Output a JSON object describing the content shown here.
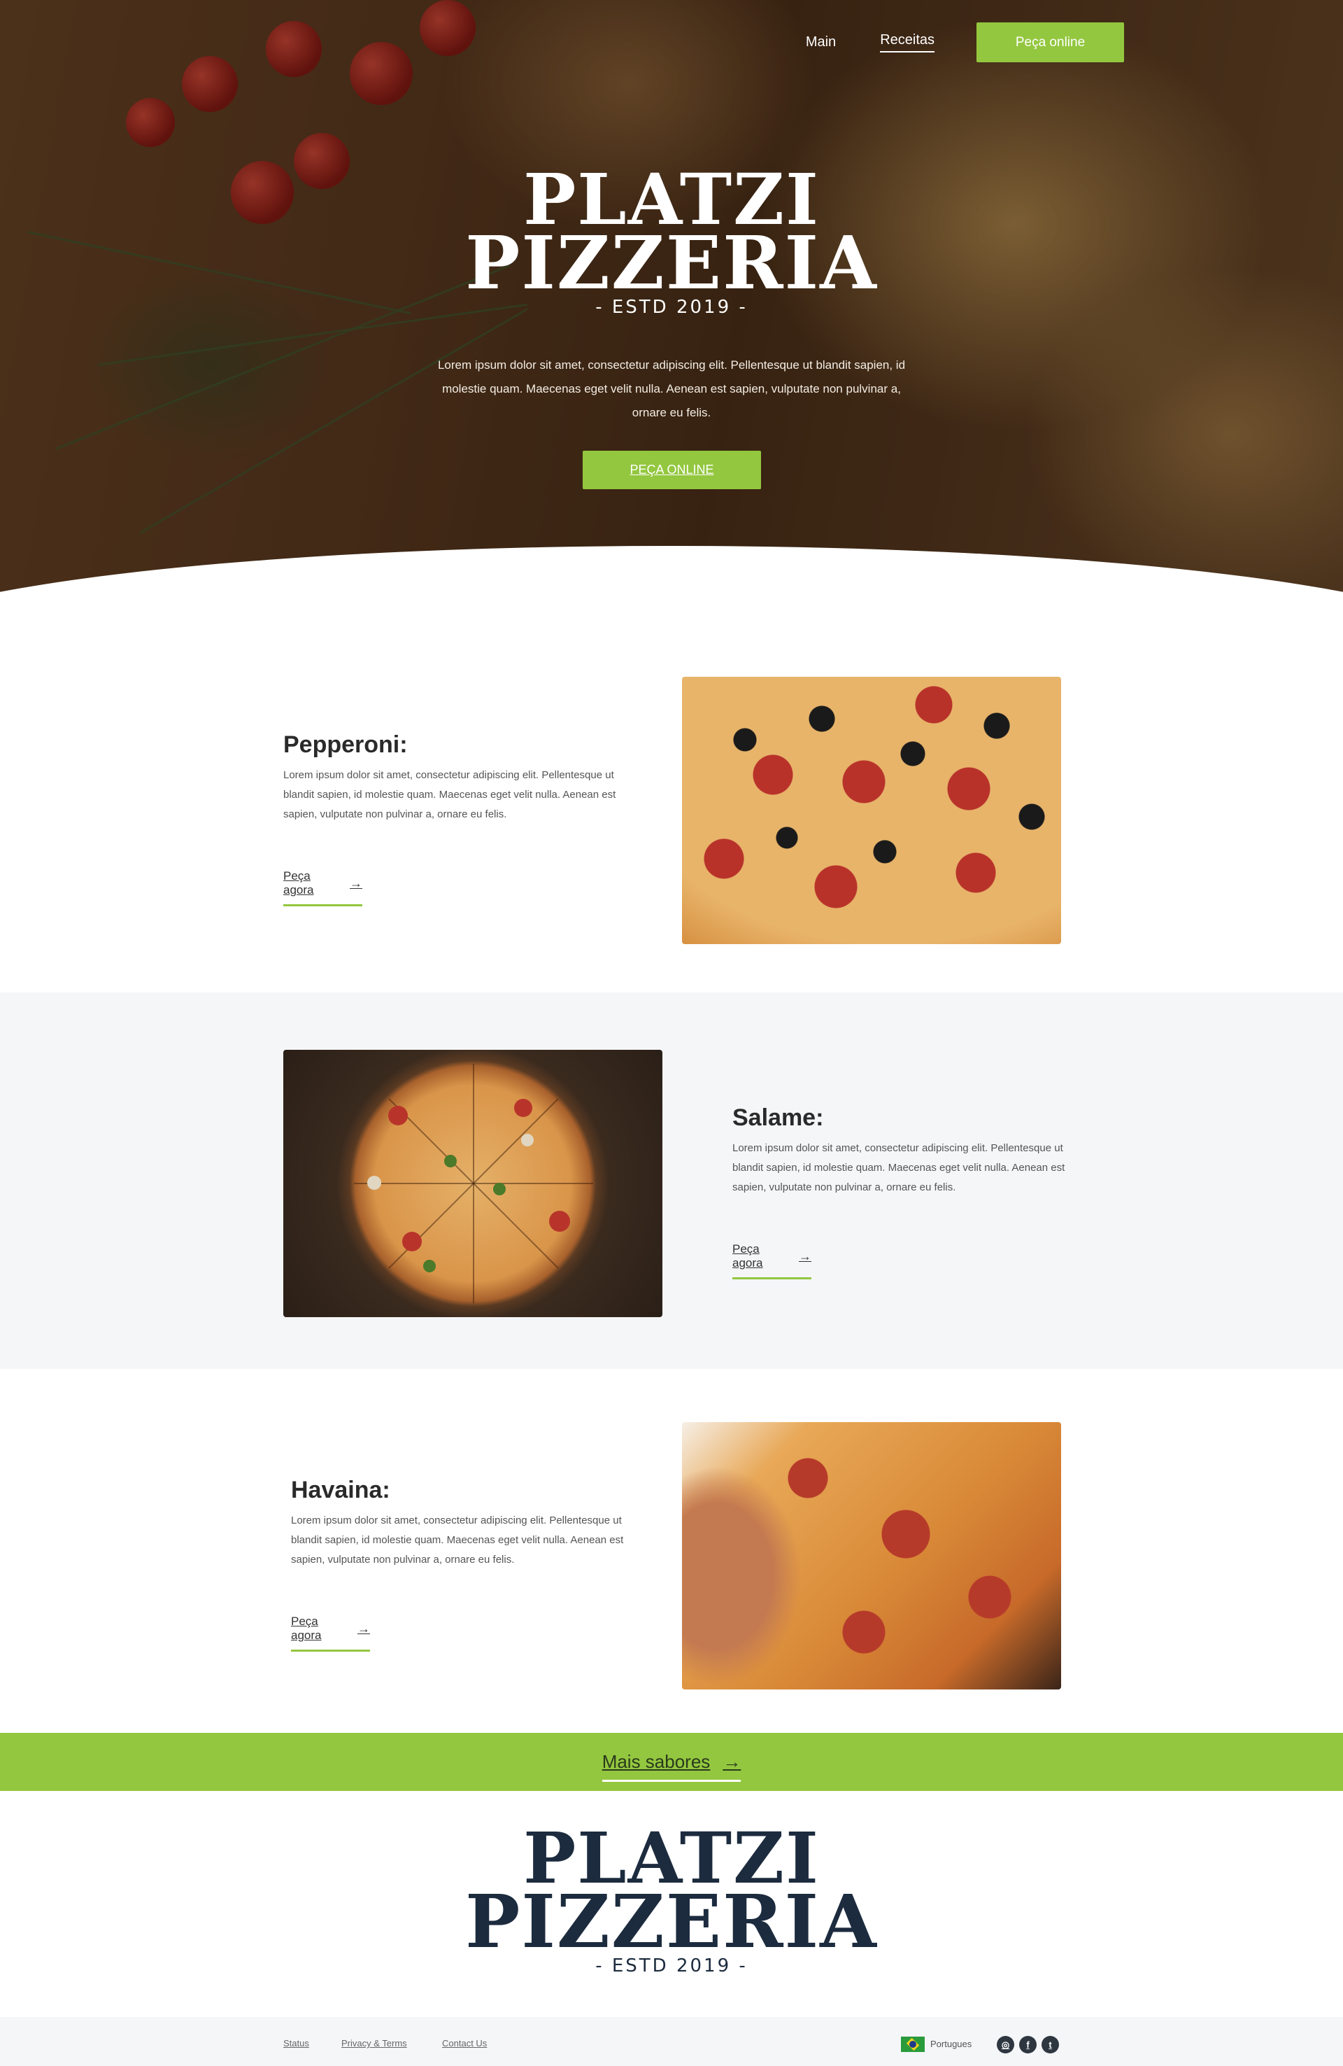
{
  "nav": {
    "main": "Main",
    "recipes": "Receitas",
    "order": "Peça online"
  },
  "logo": {
    "line1": "PLATZI",
    "line2": "PIZZERIA",
    "line3": "- ESTD 2019 -"
  },
  "hero": {
    "text": "Lorem ipsum dolor sit amet, consectetur adipiscing elit. Pellentesque ut blandit sapien, id molestie quam. Maecenas eget velit nulla. Aenean est sapien, vulputate non pulvinar a, ornare eu felis.",
    "cta": "PEÇA ONLINE"
  },
  "products": [
    {
      "title": "Pepperoni:",
      "desc": "Lorem ipsum dolor sit amet, consectetur adipiscing elit. Pellentesque ut blandit sapien, id molestie quam. Maecenas eget velit nulla. Aenean est sapien, vulputate non pulvinar a, ornare eu felis.",
      "link": "Peça agora"
    },
    {
      "title": "Salame:",
      "desc": "Lorem ipsum dolor sit amet, consectetur adipiscing elit. Pellentesque ut blandit sapien, id molestie quam. Maecenas eget velit nulla. Aenean est sapien, vulputate non pulvinar a, ornare eu felis.",
      "link": "Peça agora"
    },
    {
      "title": "Havaina:",
      "desc": "Lorem ipsum dolor sit amet, consectetur adipiscing elit. Pellentesque ut blandit sapien, id molestie quam. Maecenas eget velit nulla. Aenean est sapien, vulputate non pulvinar a, ornare eu felis.",
      "link": "Peça agora"
    }
  ],
  "more": {
    "label": "Mais sabores"
  },
  "footer": {
    "links": [
      "Status",
      "Privacy & Terms",
      "Contact Us"
    ],
    "language": "Portugues",
    "social_icons": [
      "instagram-icon",
      "facebook-icon",
      "twitter-icon"
    ]
  },
  "colors": {
    "accent": "#93c73f",
    "logo_dark": "#1c2b3e"
  }
}
